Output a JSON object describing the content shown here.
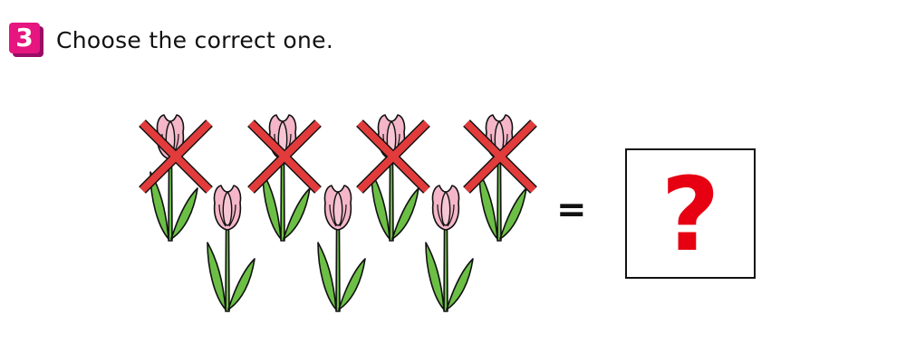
{
  "question": {
    "number": "3",
    "instruction": "Choose the correct one.",
    "badge_color": "#e6157f"
  },
  "equation": {
    "operator": "=",
    "answer_placeholder": "?",
    "answer_color": "#e60012"
  },
  "tulips": {
    "total": 7,
    "crossed_out": 4,
    "remaining": 3,
    "flower_color": "#f4b6c8",
    "leaf_color": "#6cbf45",
    "cross_color": "#e23b3b"
  }
}
